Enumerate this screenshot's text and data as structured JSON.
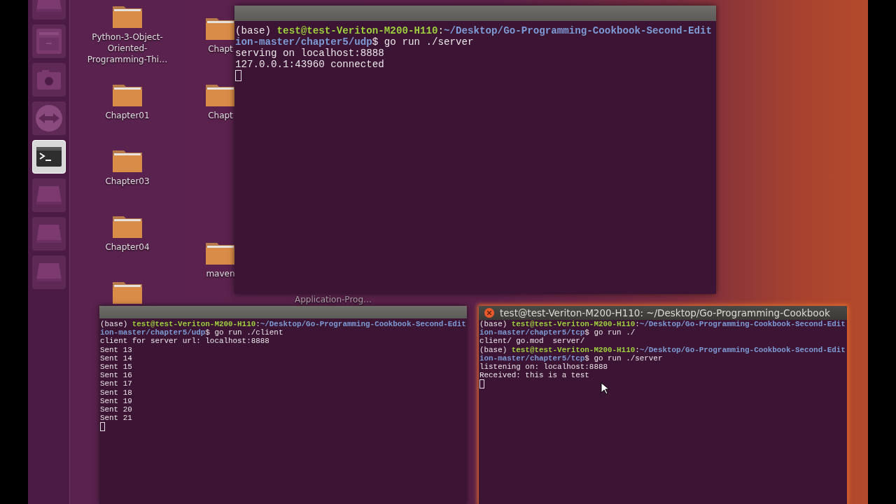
{
  "launcher": {
    "items": [
      {
        "kind": "drive",
        "selected": false
      },
      {
        "kind": "cabinet",
        "selected": false
      },
      {
        "kind": "camera",
        "selected": false
      },
      {
        "kind": "remote",
        "selected": false
      },
      {
        "kind": "terminal",
        "selected": true
      },
      {
        "kind": "drive",
        "selected": false
      },
      {
        "kind": "drive",
        "selected": false
      },
      {
        "kind": "drive",
        "selected": false
      }
    ]
  },
  "desktop_icons": [
    {
      "label": "Python-3-Object-Oriented-Programming-Thi…"
    },
    {
      "label": "Chapter01"
    },
    {
      "label": "Chapter03"
    },
    {
      "label": "Chapter04"
    },
    {
      "kind": "folder"
    },
    {
      "label": "Chapt"
    },
    {
      "label": "Chapt"
    },
    {
      "label": "maven"
    },
    {
      "label": "Application-Prog…",
      "kind": "label"
    }
  ],
  "terminals": [
    {
      "focused": false,
      "lines": [
        {
          "segs": [
            {
              "kind": "plain",
              "text": "(base) "
            },
            {
              "kind": "user",
              "text": "test@test-Veriton-M200-H110"
            },
            {
              "kind": "plain",
              "text": ":"
            },
            {
              "kind": "path",
              "text": "~/Desktop/Go-Programming-Cookbook-Second-Edit"
            }
          ]
        },
        {
          "segs": [
            {
              "kind": "path",
              "text": "ion-master/chapter5/udp"
            },
            {
              "kind": "plain",
              "text": "$ go run ./server"
            }
          ]
        },
        {
          "segs": [
            {
              "kind": "plain",
              "text": "serving on localhost:8888"
            }
          ]
        },
        {
          "segs": [
            {
              "kind": "plain",
              "text": "127.0.0.1:43960 connected"
            }
          ]
        }
      ]
    },
    {
      "focused": false,
      "lines": [
        {
          "segs": [
            {
              "kind": "plain",
              "text": "(base) "
            },
            {
              "kind": "user",
              "text": "test@test-Veriton-M200-H110"
            },
            {
              "kind": "plain",
              "text": ":"
            },
            {
              "kind": "path",
              "text": "~/Desktop/Go-Programming-Cookbook-Second-Edit"
            }
          ]
        },
        {
          "segs": [
            {
              "kind": "path",
              "text": "ion-master/chapter5/udp"
            },
            {
              "kind": "plain",
              "text": "$ go run ./client"
            }
          ]
        },
        {
          "segs": [
            {
              "kind": "plain",
              "text": "client for server url: localhost:8888"
            }
          ]
        },
        {
          "segs": [
            {
              "kind": "plain",
              "text": "Sent 13"
            }
          ]
        },
        {
          "segs": [
            {
              "kind": "plain",
              "text": "Sent 14"
            }
          ]
        },
        {
          "segs": [
            {
              "kind": "plain",
              "text": "Sent 15"
            }
          ]
        },
        {
          "segs": [
            {
              "kind": "plain",
              "text": "Sent 16"
            }
          ]
        },
        {
          "segs": [
            {
              "kind": "plain",
              "text": "Sent 17"
            }
          ]
        },
        {
          "segs": [
            {
              "kind": "plain",
              "text": "Sent 18"
            }
          ]
        },
        {
          "segs": [
            {
              "kind": "plain",
              "text": "Sent 19"
            }
          ]
        },
        {
          "segs": [
            {
              "kind": "plain",
              "text": "Sent 20"
            }
          ]
        },
        {
          "segs": [
            {
              "kind": "plain",
              "text": "Sent 21"
            }
          ]
        }
      ]
    },
    {
      "focused": true,
      "title": "test@test-Veriton-M200-H110: ~/Desktop/Go-Programming-Cookbook",
      "lines": [
        {
          "segs": [
            {
              "kind": "plain",
              "text": "(base) "
            },
            {
              "kind": "user",
              "text": "test@test-Veriton-M200-H110"
            },
            {
              "kind": "plain",
              "text": ":"
            },
            {
              "kind": "path",
              "text": "~/Desktop/Go-Programming-Cookbook-Second-Edit"
            }
          ]
        },
        {
          "segs": [
            {
              "kind": "path",
              "text": "ion-master/chapter5/tcp"
            },
            {
              "kind": "plain",
              "text": "$ go run ./"
            }
          ]
        },
        {
          "segs": [
            {
              "kind": "plain",
              "text": "client/ go.mod  server/"
            }
          ]
        },
        {
          "segs": [
            {
              "kind": "plain",
              "text": "(base) "
            },
            {
              "kind": "user",
              "text": "test@test-Veriton-M200-H110"
            },
            {
              "kind": "plain",
              "text": ":"
            },
            {
              "kind": "path",
              "text": "~/Desktop/Go-Programming-Cookbook-Second-Edit"
            }
          ]
        },
        {
          "segs": [
            {
              "kind": "path",
              "text": "ion-master/chapter5/tcp"
            },
            {
              "kind": "plain",
              "text": "$ go run ./server"
            }
          ]
        },
        {
          "segs": [
            {
              "kind": "plain",
              "text": "listening on: localhost:8888"
            }
          ]
        },
        {
          "segs": [
            {
              "kind": "plain",
              "text": "Received: this is a test"
            }
          ]
        }
      ]
    }
  ]
}
